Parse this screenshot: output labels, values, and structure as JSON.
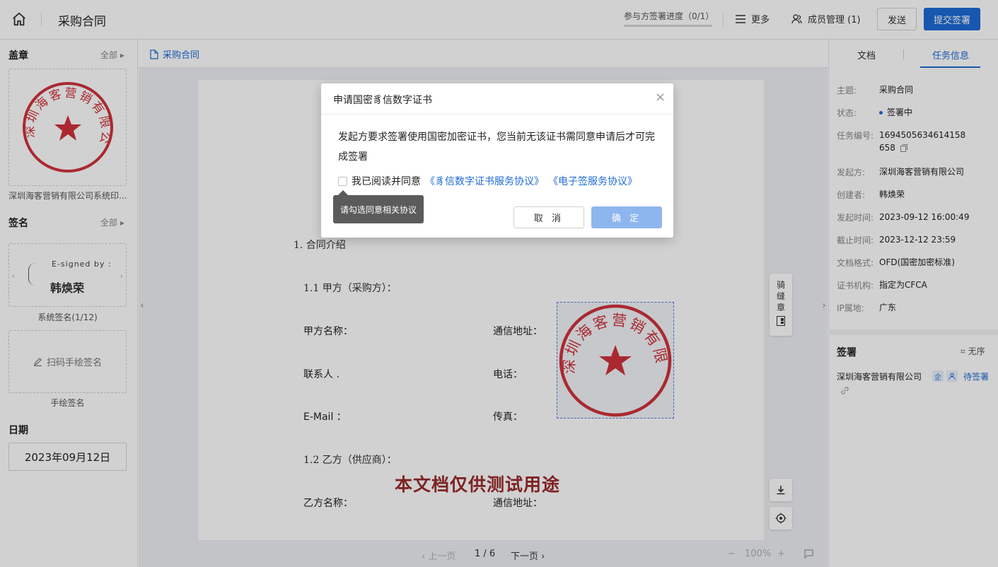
{
  "header": {
    "title": "采购合同",
    "progress_label": "参与方签署进度（0/1）",
    "more_label": "更多",
    "members_label": "成员管理 (1)",
    "send_label": "发送",
    "submit_label": "提交签署"
  },
  "left_panel": {
    "seal_section_title": "盖章",
    "seal_all": "全部",
    "seal_text": "深圳海客营销有限公司",
    "seal_caption": "深圳海客营销有限公司系统印...",
    "signature_section_title": "签名",
    "signature_all": "全部",
    "signature_esigned_label": "E-signed by :",
    "signature_name": "韩焕荣",
    "signature_caption": "系统签名(1/12)",
    "handwrite_label": "扫码手绘签名",
    "handwrite_caption": "手绘签名",
    "date_section_title": "日期",
    "date_value": "2023年09月12日"
  },
  "document": {
    "tab_label": "采购合同",
    "section_intro": "1.  合同介绍",
    "party_a_heading": "1.1   甲方（采购方）：",
    "party_a_name_label": "甲方名称：",
    "party_a_address_label": "通信地址：",
    "party_a_contact_label": "联系人   .",
    "party_a_phone_label": "电话：",
    "party_a_email_label": "E-Mail   ：",
    "party_a_fax_label": "传真：",
    "party_b_heading": "1.2   乙方（供应商）：",
    "party_b_name_label": "乙方名称：",
    "party_b_address_label": "通信地址：",
    "watermark": "本文档仅供测试用途",
    "riding_seal_label": "骑缝章",
    "placed_seal_text": "深圳海客营销有限公司"
  },
  "pager": {
    "prev_label": "上一页",
    "page_indicator": "1 / 6",
    "next_label": "下一页",
    "zoom_level": "100%"
  },
  "right_panel": {
    "tab_document": "文档",
    "tab_task_info": "任务信息",
    "info": [
      {
        "label": "主题:",
        "value": "采购合同"
      },
      {
        "label": "状态:",
        "value": "签署中"
      },
      {
        "label": "任务编号:",
        "value": "1694505634614158658"
      },
      {
        "label": "发起方:",
        "value": "深圳海客营销有限公司"
      },
      {
        "label": "创建者:",
        "value": "韩焕荣"
      },
      {
        "label": "发起时间:",
        "value": "2023-09-12 16:00:49"
      },
      {
        "label": "截止时间:",
        "value": "2023-12-12 23:59"
      },
      {
        "label": "文档格式:",
        "value": "OFD(国密加密标准)"
      },
      {
        "label": "证书机构:",
        "value": "指定为CFCA"
      },
      {
        "label": "IP属地:",
        "value": "广东"
      }
    ],
    "sign_section_title": "签署",
    "sign_order": "无序",
    "signer_company": "深圳海客营销有限公司",
    "signer_badge_org": "企",
    "signer_status": "待签署",
    "status_color": "#1e6bd6"
  },
  "modal": {
    "title": "申请国密豸信数字证书",
    "body": "发起方要求签署使用国密加密证书，您当前无该证书需同意申请后才可完成签署",
    "agree_prefix": "我已阅读并同意",
    "agreement_link_1": "《豸信数字证书服务协议》",
    "agreement_link_2": "《电子签服务协议》",
    "tooltip": "请勾选同意相关协议",
    "cancel_label": "取 消",
    "ok_label": "确 定"
  },
  "colors": {
    "accent": "#1e6bd6",
    "seal_red": "#d0323c",
    "watermark": "#9a2a2a"
  }
}
